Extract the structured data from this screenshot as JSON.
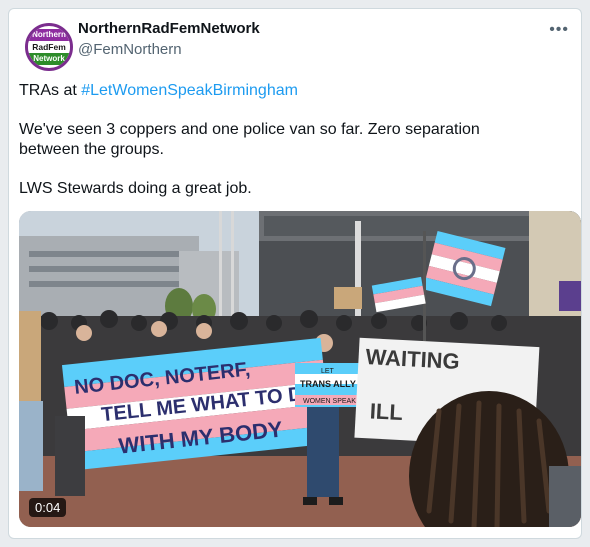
{
  "tweet": {
    "display_name": "NorthernRadFemNetwork",
    "handle": "@FemNorthern",
    "more_label": "•••",
    "avatar_lines": [
      "Northern",
      "RadFem",
      "Network"
    ],
    "text_prefix": "TRAs at ",
    "hashtag": "#LetWomenSpeakBirmingham",
    "line2": "We've seen 3 coppers and one police van so far. Zero separation",
    "line3": "between the groups.",
    "line4": "LWS Stewards doing a great job."
  },
  "media": {
    "duration": "0:04",
    "banner_main": "NO DOC, NO TERF, TELL ME WHAT TO DO WITH MY BODY",
    "banner_left": "NO DOC, NOTERF,",
    "banner_mid": "TELL ME WHAT TO DO",
    "banner_bottom": "WITH MY BODY",
    "sign_trans_1": "LET",
    "sign_trans_2": "TRANS ALLY",
    "sign_trans_3": "WOMEN SPEAK",
    "sign_right_1": "WAITING",
    "sign_right_2": "ILL"
  },
  "colors": {
    "link": "#1d9bf0",
    "trans_blue": "#5bcefa",
    "trans_pink": "#f5a9b8"
  }
}
